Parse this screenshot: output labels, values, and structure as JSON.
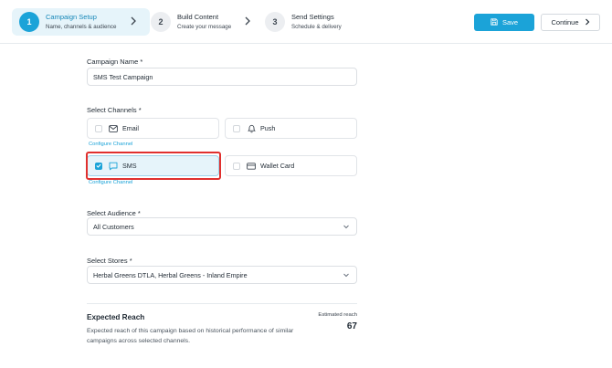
{
  "steps": [
    {
      "number": "1",
      "title": "Campaign Setup",
      "subtitle": "Name, channels & audience"
    },
    {
      "number": "2",
      "title": "Build Content",
      "subtitle": "Create your message"
    },
    {
      "number": "3",
      "title": "Send Settings",
      "subtitle": "Schedule & delivery"
    }
  ],
  "actions": {
    "save_label": "Save",
    "continue_label": "Continue"
  },
  "form": {
    "campaign_name": {
      "label": "Campaign Name *",
      "value": "SMS Test Campaign"
    },
    "channels": {
      "label": "Select Channels *",
      "configure_label": "Configure Channel",
      "items": [
        {
          "label": "Email",
          "icon": "mail-icon",
          "checked": false
        },
        {
          "label": "Push",
          "icon": "bell-icon",
          "checked": false
        },
        {
          "label": "SMS",
          "icon": "chat-icon",
          "checked": true
        },
        {
          "label": "Wallet Card",
          "icon": "card-icon",
          "checked": false
        }
      ]
    },
    "audience": {
      "label": "Select Audience *",
      "value": "All Customers"
    },
    "stores": {
      "label": "Select Stores *",
      "value": "Herbal Greens DTLA, Herbal Greens - Inland Empire"
    }
  },
  "reach": {
    "title": "Expected Reach",
    "description": "Expected reach of this campaign based on historical performance of similar campaigns across selected channels.",
    "estimated_label": "Estimated reach",
    "estimated_value": "67"
  },
  "colors": {
    "accent": "#1ba3d8",
    "highlight": "#e0302e"
  }
}
